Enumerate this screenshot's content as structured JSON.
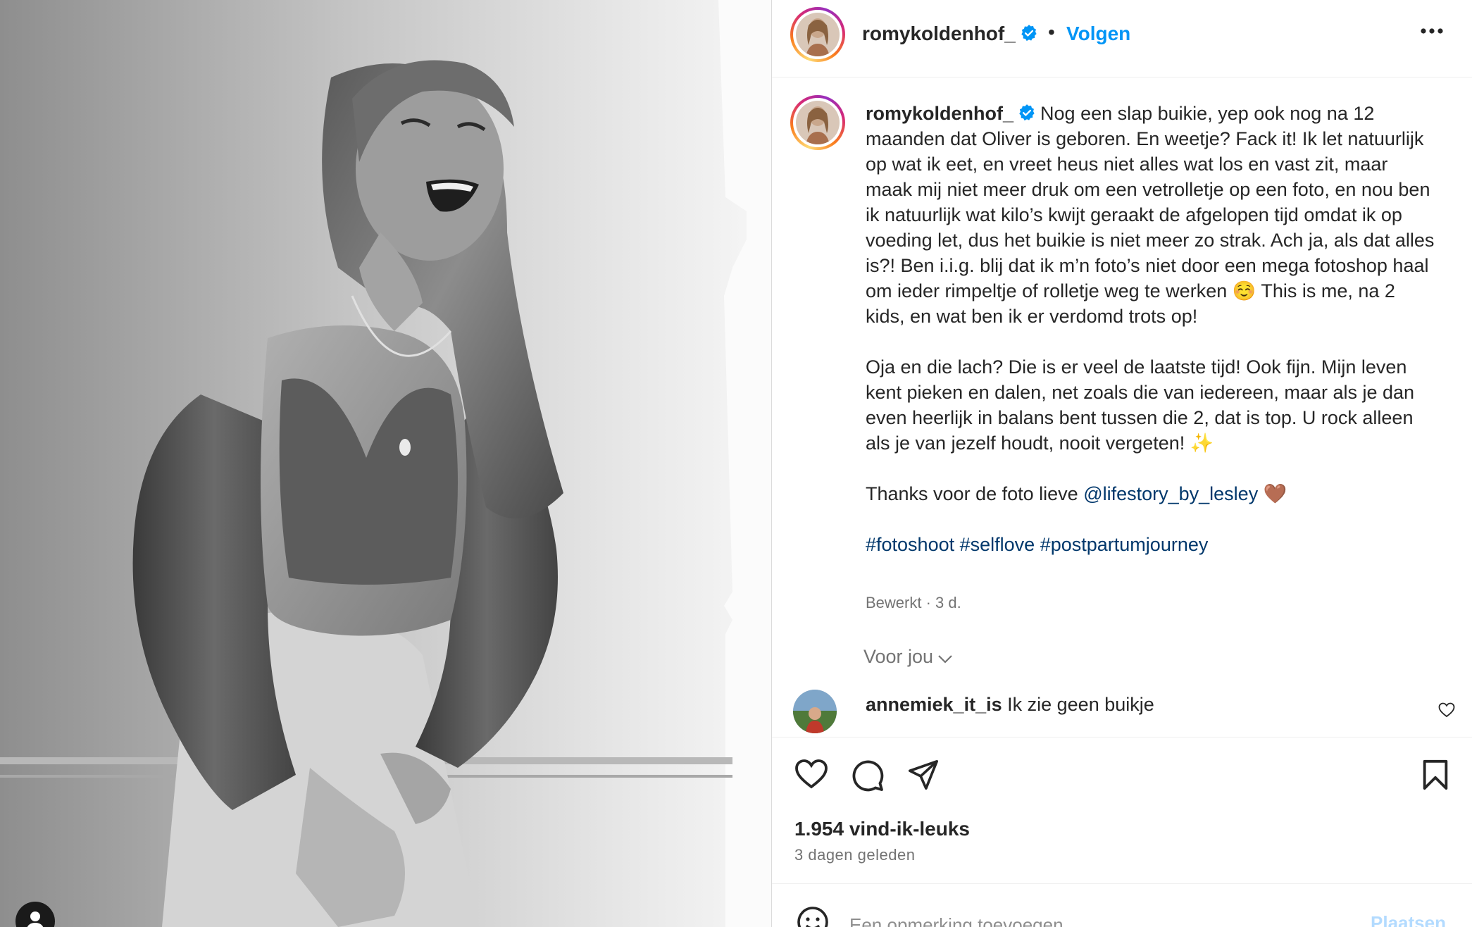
{
  "post": {
    "username": "romykoldenhof_",
    "follow_label": "Volgen",
    "separator": "•",
    "caption_paragraphs": [
      "Nog een slap buikie, yep ook nog na 12 maanden dat Oliver is geboren. En weetje? Fack it! Ik let natuurlijk op wat ik eet, en vreet heus niet alles wat los en vast zit, maar maak mij niet meer druk om een vetrolletje op een foto, en nou ben ik natuurlijk wat kilo’s kwijt geraakt de afgelopen tijd omdat ik op voeding let, dus het buikie is niet meer zo strak. Ach ja, als dat alles is?! Ben i.i.g. blij dat ik m’n foto’s niet door een mega fotoshop haal om ieder rimpeltje of rolletje weg te werken ☺️ This is me, na 2 kids, en wat ben ik er verdomd trots op!",
      "Oja en die lach? Die is er veel de laatste tijd! Ook fijn. Mijn leven kent pieken en dalen, net zoals die van iedereen, maar als je dan even heerlijk in balans bent tussen die 2, dat is top. U rock alleen als je van jezelf houdt, nooit vergeten! ✨"
    ],
    "thanks_text": "Thanks voor de foto lieve",
    "thanks_mention": "@lifestory_by_lesley",
    "thanks_emoji": "🤎",
    "hashtags": [
      "#fotoshoot",
      "#selflove",
      "#postpartumjourney"
    ],
    "meta": "Bewerkt · 3 d.",
    "for_you_label": "Voor jou",
    "likes": "1.954 vind-ik-leuks",
    "time_ago": "3 dagen geleden"
  },
  "comments": [
    {
      "user": "annemiek_it_is",
      "text": "Ik zie geen buikje"
    }
  ],
  "comment_box": {
    "placeholder": "Een opmerking toevoegen...",
    "post_label": "Plaatsen"
  },
  "icons": {
    "verified": "verified-badge-icon",
    "more": "more-options-icon",
    "like": "heart-icon",
    "comment": "comment-bubble-icon",
    "share": "paper-plane-icon",
    "save": "bookmark-icon",
    "emoji": "emoji-icon",
    "user_tags": "user-icon",
    "chevron": "chevron-down-icon"
  },
  "colors": {
    "link_blue": "#0095f6",
    "mention_blue": "#00376b",
    "muted_text": "#737373",
    "post_disabled": "#b3dbff"
  }
}
